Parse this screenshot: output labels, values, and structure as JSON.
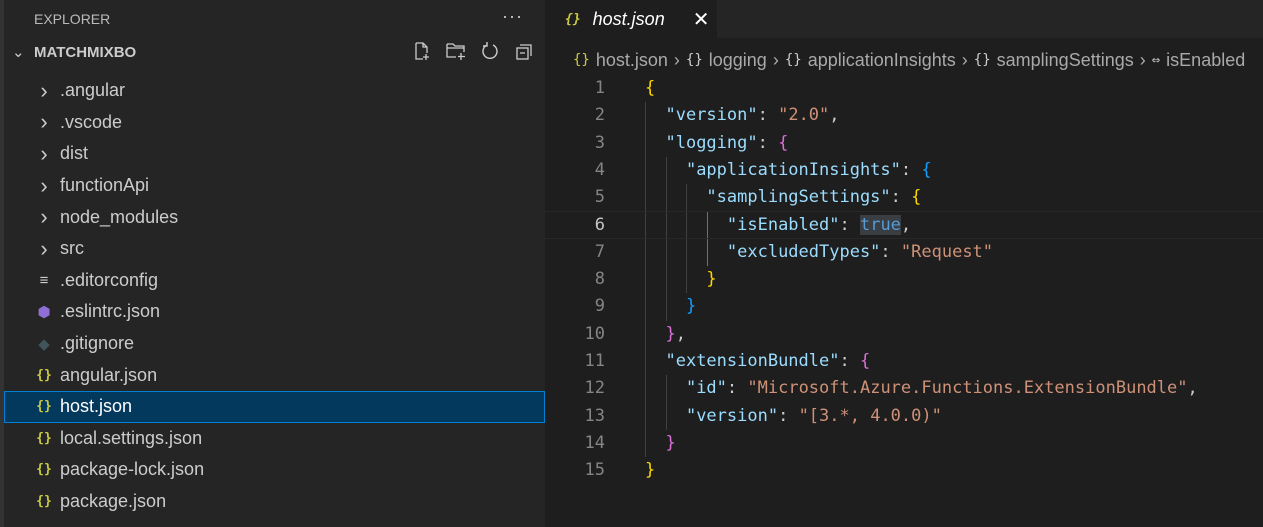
{
  "sidebar": {
    "title": "EXPLORER",
    "more": "···",
    "root": "MATCHMIXBO",
    "items": [
      {
        "label": ".angular",
        "type": "folder"
      },
      {
        "label": ".vscode",
        "type": "folder"
      },
      {
        "label": "dist",
        "type": "folder"
      },
      {
        "label": "functionApi",
        "type": "folder"
      },
      {
        "label": "node_modules",
        "type": "folder"
      },
      {
        "label": "src",
        "type": "folder"
      },
      {
        "label": ".editorconfig",
        "type": "config"
      },
      {
        "label": ".eslintrc.json",
        "type": "eslint"
      },
      {
        "label": ".gitignore",
        "type": "git"
      },
      {
        "label": "angular.json",
        "type": "json"
      },
      {
        "label": "host.json",
        "type": "json",
        "selected": true
      },
      {
        "label": "local.settings.json",
        "type": "json"
      },
      {
        "label": "package-lock.json",
        "type": "json"
      },
      {
        "label": "package.json",
        "type": "json"
      }
    ]
  },
  "tab": {
    "label": "host.json",
    "icon": "{}"
  },
  "breadcrumbs": [
    {
      "label": "host.json",
      "icon": "{}"
    },
    {
      "label": "logging",
      "icon": "{}"
    },
    {
      "label": "applicationInsights",
      "icon": "{}"
    },
    {
      "label": "samplingSettings",
      "icon": "{}"
    },
    {
      "label": "isEnabled",
      "icon": "⇔"
    }
  ],
  "code": {
    "current_line": 6,
    "lines": [
      [
        [
          "y",
          "{"
        ]
      ],
      [
        [
          "p",
          "  "
        ],
        [
          "k",
          "\"version\""
        ],
        [
          "p",
          ": "
        ],
        [
          "s",
          "\"2.0\""
        ],
        [
          "p",
          ","
        ]
      ],
      [
        [
          "p",
          "  "
        ],
        [
          "k",
          "\"logging\""
        ],
        [
          "p",
          ": "
        ],
        [
          "m",
          "{"
        ]
      ],
      [
        [
          "p",
          "    "
        ],
        [
          "k",
          "\"applicationInsights\""
        ],
        [
          "p",
          ": "
        ],
        [
          "c",
          "{"
        ]
      ],
      [
        [
          "p",
          "      "
        ],
        [
          "k",
          "\"samplingSettings\""
        ],
        [
          "p",
          ": "
        ],
        [
          "y",
          "{"
        ]
      ],
      [
        [
          "p",
          "        "
        ],
        [
          "k",
          "\"isEnabled\""
        ],
        [
          "p",
          ": "
        ],
        [
          "b hl",
          "true"
        ],
        [
          "p",
          ","
        ]
      ],
      [
        [
          "p",
          "        "
        ],
        [
          "k",
          "\"excludedTypes\""
        ],
        [
          "p",
          ": "
        ],
        [
          "s",
          "\"Request\""
        ]
      ],
      [
        [
          "p",
          "      "
        ],
        [
          "y",
          "}"
        ]
      ],
      [
        [
          "p",
          "    "
        ],
        [
          "c",
          "}"
        ]
      ],
      [
        [
          "p",
          "  "
        ],
        [
          "m",
          "}"
        ],
        [
          "p",
          ","
        ]
      ],
      [
        [
          "p",
          "  "
        ],
        [
          "k",
          "\"extensionBundle\""
        ],
        [
          "p",
          ": "
        ],
        [
          "m",
          "{"
        ]
      ],
      [
        [
          "p",
          "    "
        ],
        [
          "k",
          "\"id\""
        ],
        [
          "p",
          ": "
        ],
        [
          "s",
          "\"Microsoft.Azure.Functions.ExtensionBundle\""
        ],
        [
          "p",
          ","
        ]
      ],
      [
        [
          "p",
          "    "
        ],
        [
          "k",
          "\"version\""
        ],
        [
          "p",
          ": "
        ],
        [
          "s",
          "\"[3.*, 4.0.0)\""
        ]
      ],
      [
        [
          "p",
          "  "
        ],
        [
          "m",
          "}"
        ]
      ],
      [
        [
          "y",
          "}"
        ]
      ]
    ]
  }
}
